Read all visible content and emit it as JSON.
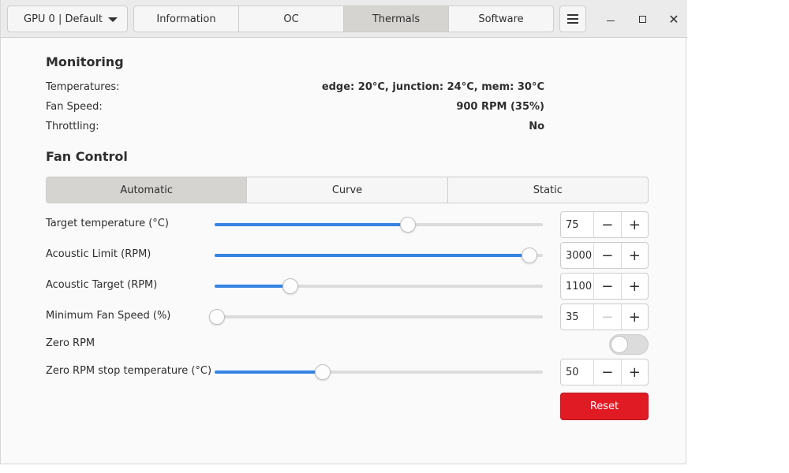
{
  "header": {
    "gpu_select": "GPU 0 | Default",
    "tabs": [
      "Information",
      "OC",
      "Thermals",
      "Software"
    ],
    "active_tab": "Thermals"
  },
  "monitoring": {
    "title": "Monitoring",
    "rows": [
      {
        "label": "Temperatures:",
        "value": "edge: 20°C, junction: 24°C, mem: 30°C"
      },
      {
        "label": "Fan Speed:",
        "value": "900 RPM (35%)"
      },
      {
        "label": "Throttling:",
        "value": "No"
      }
    ]
  },
  "fan_control": {
    "title": "Fan Control",
    "modes": [
      "Automatic",
      "Curve",
      "Static"
    ],
    "active_mode": "Automatic",
    "settings": [
      {
        "label": "Target temperature (°C)",
        "value": "75",
        "fill": 0.59
      },
      {
        "label": "Acoustic Limit (RPM)",
        "value": "3000",
        "fill": 0.96
      },
      {
        "label": "Acoustic Target (RPM)",
        "value": "1100",
        "fill": 0.23
      },
      {
        "label": "Minimum Fan Speed (%)",
        "value": "35",
        "fill": 0.0
      }
    ],
    "zero_rpm": {
      "label": "Zero RPM",
      "enabled": false
    },
    "zero_rpm_stop": {
      "label": "Zero RPM stop temperature (°C)",
      "value": "50",
      "fill": 0.33
    },
    "reset_label": "Reset"
  },
  "colors": {
    "accent": "#3584e4",
    "destructive": "#e01b24"
  }
}
